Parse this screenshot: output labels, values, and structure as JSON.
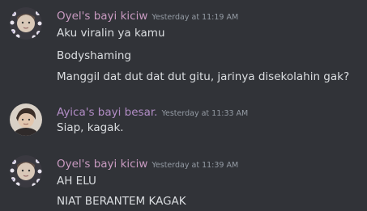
{
  "colors": {
    "background": "#313338",
    "username_pink": "#c89ac0",
    "username_purple": "#b28dc6",
    "timestamp": "#949ba4",
    "text": "#dbdee1"
  },
  "messages": [
    {
      "username": "Oyel's bayi kiciw",
      "timestamp": "Yesterday at 11:19 AM",
      "avatar": "flower-framed-avatar",
      "lines": [
        "Aku viralin ya kamu",
        "Bodyshaming",
        "Manggil dat dut dat dut gitu, jarinya disekolahin gak?"
      ]
    },
    {
      "username": "Ayica's bayi besar.",
      "timestamp": "Yesterday at 11:33 AM",
      "avatar": "portrait-avatar",
      "lines": [
        "Siap, kagak."
      ]
    },
    {
      "username": "Oyel's bayi kiciw",
      "timestamp": "Yesterday at 11:39 AM",
      "avatar": "flower-framed-avatar",
      "lines": [
        "AH ELU",
        "NIAT BERANTEM KAGAK"
      ]
    }
  ]
}
